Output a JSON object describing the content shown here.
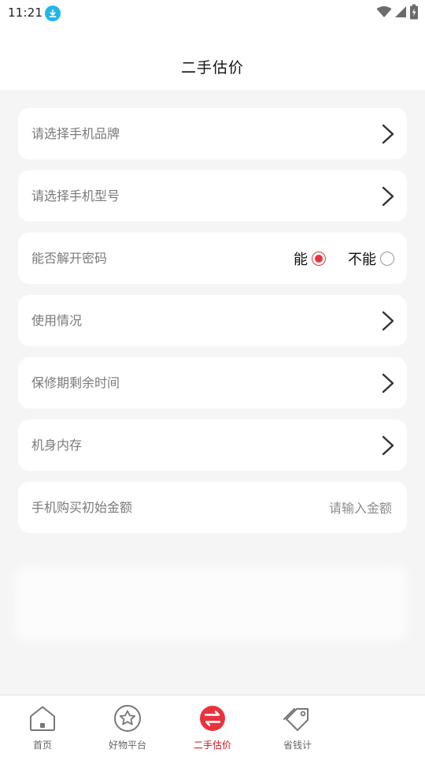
{
  "status": {
    "time": "11:21"
  },
  "header": {
    "title": "二手估价"
  },
  "form": {
    "brand_label": "请选择手机品牌",
    "model_label": "请选择手机型号",
    "unlock_label": "能否解开密码",
    "unlock_options": [
      "能",
      "不能"
    ],
    "unlock_selected": "能",
    "usage_label": "使用情况",
    "warranty_label": "保修期剩余时间",
    "storage_label": "机身内存",
    "price_label": "手机购买初始金额",
    "price_placeholder": "请输入金额",
    "price_value": ""
  },
  "tabs": [
    {
      "label": "首页",
      "icon": "home-icon"
    },
    {
      "label": "好物平台",
      "icon": "star-icon"
    },
    {
      "label": "二手估价",
      "icon": "exchange-icon",
      "active": true
    },
    {
      "label": "省钱计",
      "icon": "tag-icon"
    },
    {
      "label": "",
      "icon": "user-icon"
    }
  ],
  "colors": {
    "accent": "#e8333e",
    "tab_active": "#d0101e",
    "background": "#f5f5f5",
    "download_badge": "#22b6e8"
  }
}
